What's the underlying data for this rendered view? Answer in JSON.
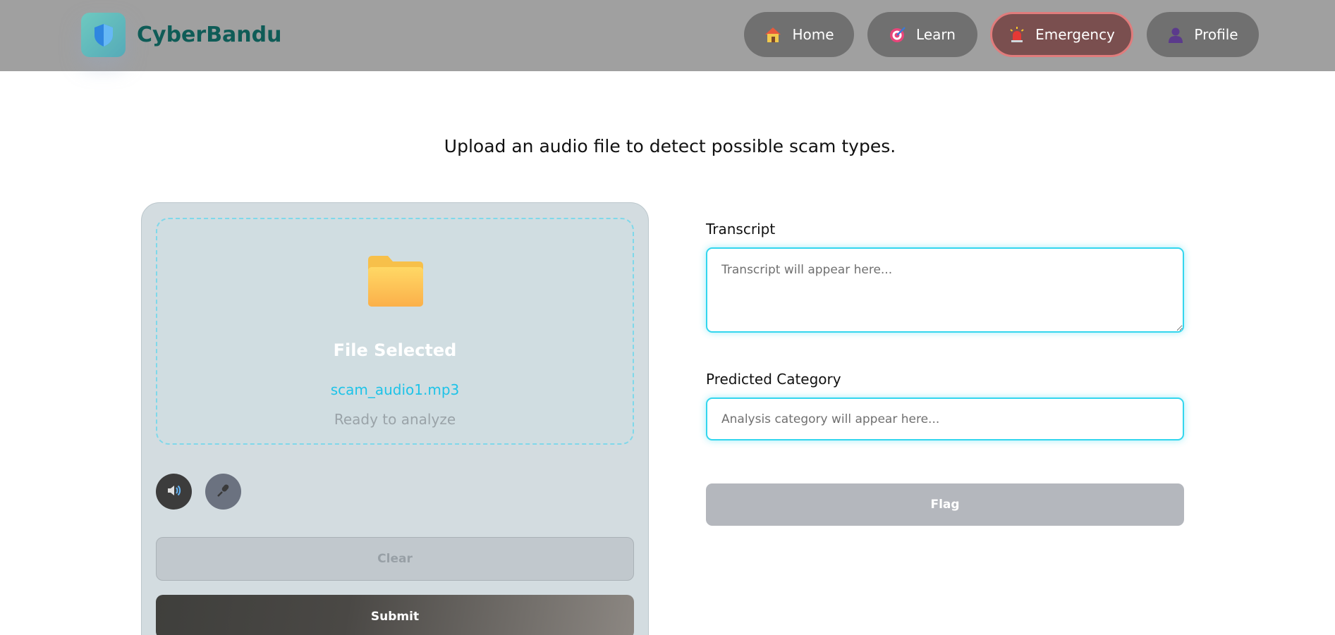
{
  "brand": {
    "name": "CyberBandu",
    "logo_icon": "shield-icon"
  },
  "nav": {
    "home": {
      "label": "Home",
      "icon": "house-icon"
    },
    "learn": {
      "label": "Learn",
      "icon": "target-icon"
    },
    "emergency": {
      "label": "Emergency",
      "icon": "siren-icon",
      "active": true
    },
    "profile": {
      "label": "Profile",
      "icon": "user-icon"
    }
  },
  "page": {
    "subtitle": "Upload an audio file to detect possible scam types."
  },
  "upload": {
    "icon": "folder-icon",
    "status_title": "File Selected",
    "file_name": "scam_audio1.mp3",
    "status_text": "Ready to analyze",
    "speaker_icon": "speaker-icon",
    "mic_icon": "microphone-icon",
    "clear_label": "Clear",
    "submit_label": "Submit"
  },
  "results": {
    "transcript_label": "Transcript",
    "transcript_placeholder": "Transcript will appear here...",
    "transcript_value": "",
    "category_label": "Predicted Category",
    "category_placeholder": "Analysis category will appear here...",
    "category_value": "",
    "flag_label": "Flag"
  },
  "colors": {
    "brand_text": "#0f5c57",
    "accent_cyan": "#33d6ee",
    "file_name": "#1ec3e8",
    "emergency_border": "#e07c7c"
  }
}
